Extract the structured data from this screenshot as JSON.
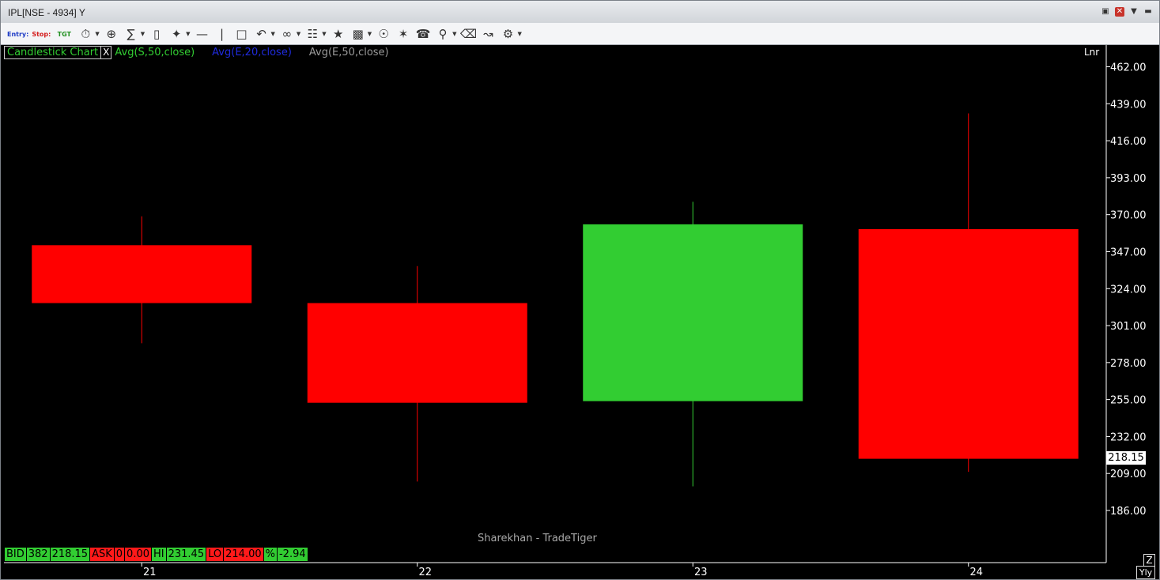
{
  "window": {
    "title": "IPL[NSE - 4934] Y"
  },
  "toolbar": {
    "entry_label": "Entry:",
    "stop_label": "Stop:",
    "tgt_label": "TGT"
  },
  "legend": {
    "title": "Candlestick Chart",
    "close_label": "X",
    "indicators": [
      {
        "label": "Avg(S,50,close)",
        "color": "#32cd32"
      },
      {
        "label": "Avg(E,20,close)",
        "color": "#1f2bdc"
      },
      {
        "label": "Avg(E,50,close)",
        "color": "#9a9a9a"
      }
    ],
    "scale_mode": "Lnr"
  },
  "watermark": "Sharekhan - TradeTiger",
  "quote_bar": {
    "bid_label": "BID",
    "bid_qty": "382",
    "bid_price": "218.15",
    "ask_label": "ASK",
    "ask_qty": "0",
    "ask_price": "0.00",
    "hi_label": "HI",
    "hi_value": "231.45",
    "lo_label": "LO",
    "lo_value": "214.00",
    "pct_label": "%",
    "pct_value": "-2.94"
  },
  "last_price_tag": "218.15",
  "zoom_label": "Z",
  "yly_label": "Yly",
  "colors": {
    "up": "#32cd32",
    "down": "#ff0000",
    "background": "#000000"
  },
  "chart_data": {
    "type": "candlestick",
    "categories": [
      "21",
      "22",
      "23",
      "24"
    ],
    "candles": [
      {
        "x": "21",
        "open": 351,
        "close": 315,
        "high": 369,
        "low": 290
      },
      {
        "x": "22",
        "open": 315,
        "close": 253,
        "high": 338,
        "low": 204
      },
      {
        "x": "23",
        "open": 254,
        "close": 364,
        "high": 378,
        "low": 201
      },
      {
        "x": "24",
        "open": 361,
        "close": 218.15,
        "high": 433,
        "low": 210
      }
    ],
    "y_ticks": [
      "462.00",
      "439.00",
      "416.00",
      "393.00",
      "370.00",
      "347.00",
      "324.00",
      "301.00",
      "278.00",
      "255.00",
      "232.00",
      "209.00",
      "186.00"
    ],
    "ylim": [
      160,
      470
    ],
    "grid": false,
    "legend": "top-left"
  }
}
